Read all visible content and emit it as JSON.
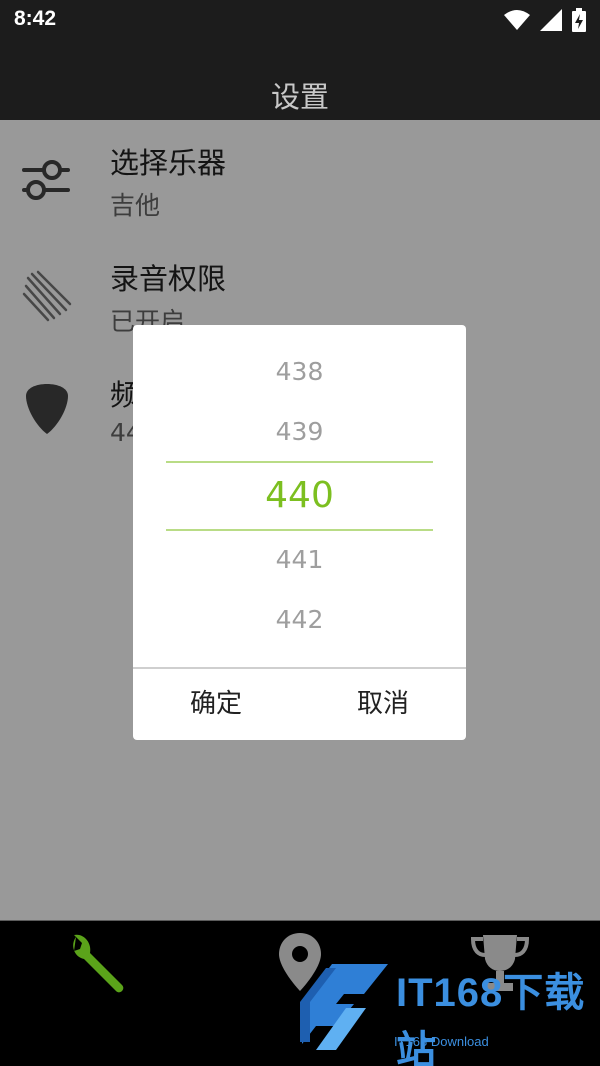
{
  "status_bar": {
    "time": "8:42",
    "icons": [
      "wifi-icon",
      "cell-signal-icon",
      "battery-charging-icon"
    ]
  },
  "app_bar": {
    "title": "设置"
  },
  "settings": {
    "items": [
      {
        "title": "选择乐器",
        "subtitle": "吉他",
        "icon": "sliders-icon"
      },
      {
        "title": "录音权限",
        "subtitle": "已开启",
        "icon": "strings-icon"
      },
      {
        "title": "频",
        "subtitle": "44",
        "icon": "guitar-pick-icon"
      }
    ]
  },
  "dialog": {
    "values": [
      "438",
      "439",
      "440",
      "441",
      "442"
    ],
    "selected": "440",
    "confirm_label": "确定",
    "cancel_label": "取消",
    "accent_color": "#7cbf20"
  },
  "bottom_nav": {
    "items": [
      {
        "icon": "wrench-icon",
        "active": true
      },
      {
        "icon": "map-pin-icon",
        "active": false
      },
      {
        "icon": "trophy-icon",
        "active": false
      }
    ],
    "active_color": "#5ba31a"
  },
  "watermark": {
    "text": "IT168下载站",
    "subtext": "IT168 Download"
  }
}
